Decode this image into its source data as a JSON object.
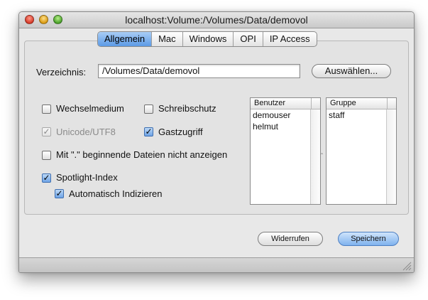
{
  "window": {
    "title": "localhost:Volume:/Volumes/Data/demovol"
  },
  "tabs": [
    {
      "label": "Allgemein",
      "active": true
    },
    {
      "label": "Mac",
      "active": false
    },
    {
      "label": "Windows",
      "active": false
    },
    {
      "label": "OPI",
      "active": false
    },
    {
      "label": "IP Access",
      "active": false
    }
  ],
  "directory": {
    "label": "Verzeichnis:",
    "value": "/Volumes/Data/demovol",
    "choose_label": "Auswählen..."
  },
  "options": {
    "removable": {
      "label": "Wechselmedium",
      "checked": false
    },
    "write_protect": {
      "label": "Schreibschutz",
      "checked": false
    },
    "unicode": {
      "label": "Unicode/UTF8",
      "checked": true,
      "disabled": true
    },
    "guest_access": {
      "label": "Gastzugriff",
      "checked": true
    },
    "hide_dotfiles": {
      "label": "Mit \".\" beginnende Dateien nicht anzeigen",
      "checked": false
    },
    "spotlight": {
      "label": "Spotlight-Index",
      "checked": true
    },
    "auto_index": {
      "label": "Automatisch Indizieren",
      "checked": true
    }
  },
  "users_list": {
    "header": "Benutzer",
    "items": [
      "demouser",
      "helmut"
    ]
  },
  "groups_list": {
    "header": "Gruppe",
    "items": [
      "staff"
    ]
  },
  "buttons": {
    "revert_label": "Widerrufen",
    "save_label": "Speichern"
  },
  "colors": {
    "accent": "#5b9ae6",
    "window_bg": "#e8e8e8"
  }
}
